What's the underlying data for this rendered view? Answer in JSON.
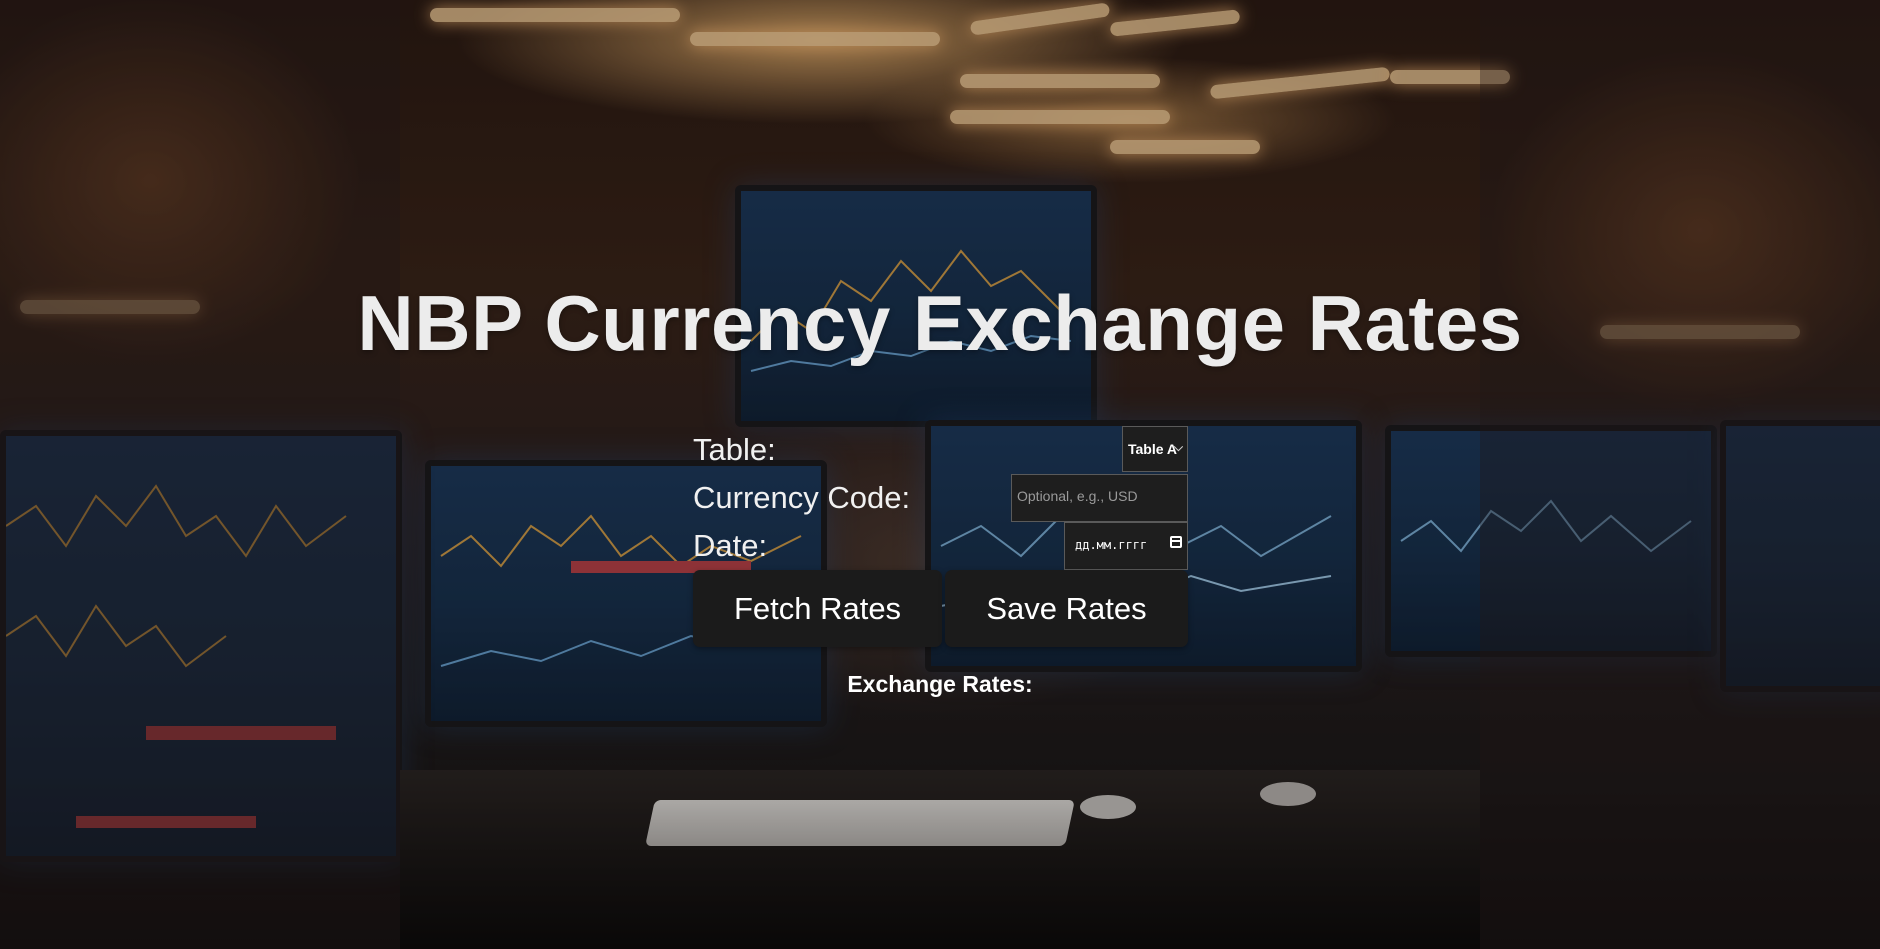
{
  "page": {
    "title": "NBP Currency Exchange Rates"
  },
  "form": {
    "table_label": "Table:",
    "table_selected": "Table A",
    "currency_label": "Currency Code:",
    "currency_placeholder": "Optional, e.g., USD",
    "currency_value": "",
    "date_label": "Date:",
    "date_placeholder": "дд.мм.гггг"
  },
  "actions": {
    "fetch_label": "Fetch Rates",
    "save_label": "Save Rates"
  },
  "results": {
    "heading": "Exchange Rates:"
  },
  "icons": {
    "select": "chevron-down-icon",
    "date": "calendar-icon"
  },
  "colors": {
    "button_bg": "#1b1b1b",
    "field_bg": "#1e1e1e",
    "title_text": "#ececec",
    "field_border": "#5a5a5a"
  }
}
